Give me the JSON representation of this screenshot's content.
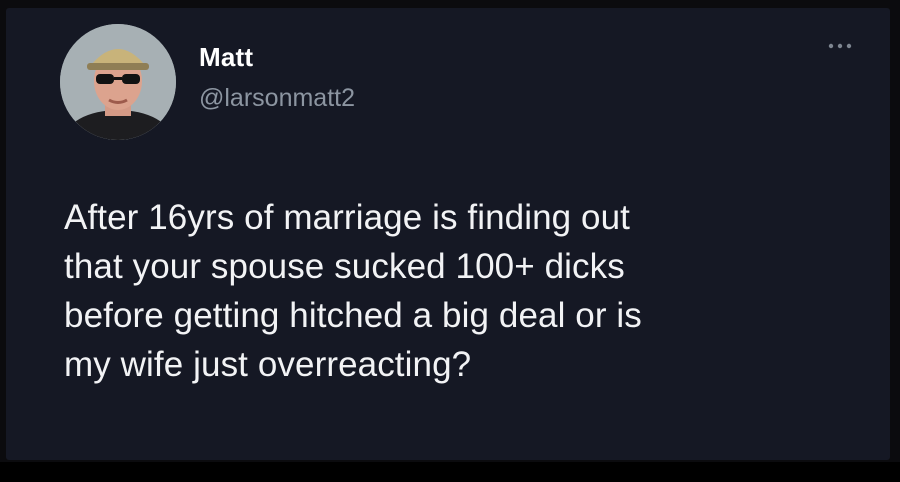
{
  "tweet": {
    "author": {
      "name": "Matt",
      "handle": "@larsonmatt2"
    },
    "text": "After 16yrs of marriage is finding out\nthat your spouse sucked 100+ dicks\nbefore getting hitched a big deal or is\nmy wife just overreacting?",
    "more_icon": "more-horizontal-icon"
  },
  "colors": {
    "background": "#151824",
    "name": "#ffffff",
    "handle": "#8c95a1",
    "text": "#f2f3f5"
  }
}
